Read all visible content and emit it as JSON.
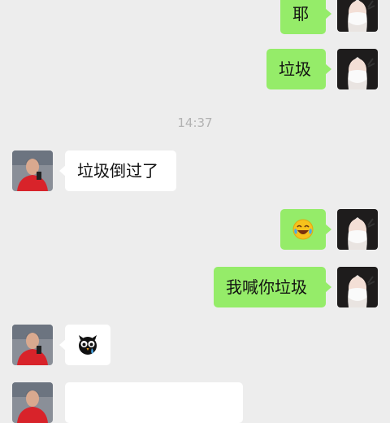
{
  "conversation": {
    "messages": [
      {
        "sender": "me",
        "type": "text",
        "text": "耶"
      },
      {
        "sender": "me",
        "type": "text",
        "text": "垃圾"
      },
      {
        "type": "timestamp",
        "text": "14:37"
      },
      {
        "sender": "other",
        "type": "text",
        "text": "垃圾倒过了"
      },
      {
        "sender": "me",
        "type": "emoji",
        "emoji": "laughing-crying-emoji"
      },
      {
        "sender": "me",
        "type": "text",
        "text": "我喊你垃圾"
      },
      {
        "sender": "other",
        "type": "sticker",
        "emoji": "crying-owl-sticker"
      },
      {
        "sender": "other",
        "type": "text",
        "text": ""
      }
    ]
  },
  "colors": {
    "background": "#ededed",
    "my_bubble": "#95ec69",
    "their_bubble": "#ffffff",
    "timestamp": "#b2b2b2"
  }
}
